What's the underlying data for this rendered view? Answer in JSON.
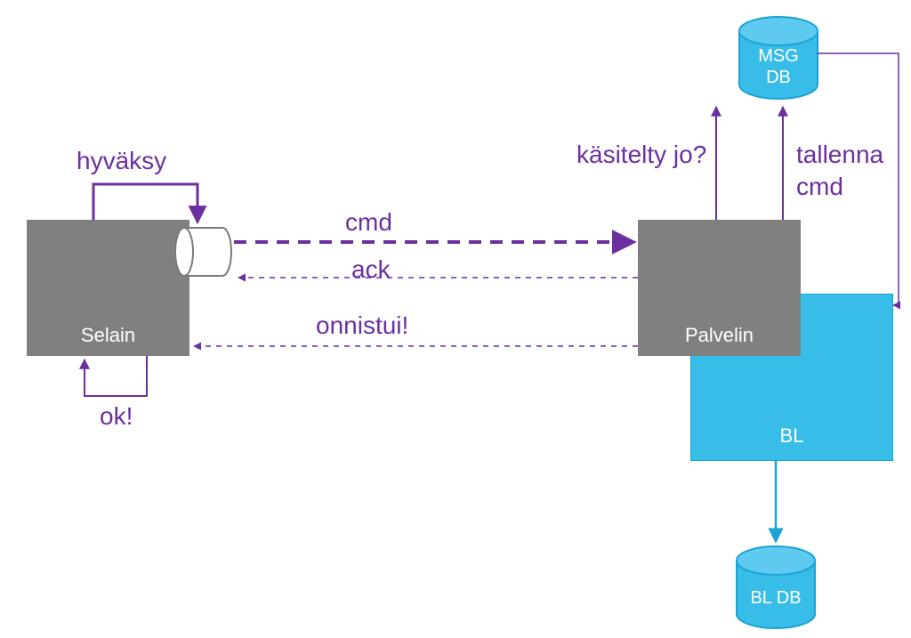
{
  "colors": {
    "gray": "#808080",
    "purple": "#6b2fa0",
    "blue": "#38bce8",
    "blueStroke": "#1aa3d4"
  },
  "nodes": {
    "selain": {
      "label": "Selain"
    },
    "palvelin": {
      "label": "Palvelin"
    },
    "bl": {
      "label": "BL"
    },
    "msgdb": {
      "label1": "MSG",
      "label2": "DB"
    },
    "bldb": {
      "label": "BL DB"
    }
  },
  "labels": {
    "hyvaksy": "hyväksy",
    "cmd": "cmd",
    "ack": "ack",
    "onnistui": "onnistui!",
    "ok": "ok!",
    "kasitelty": "käsitelty jo?",
    "tallenna1": "tallenna",
    "tallenna2": "cmd"
  }
}
